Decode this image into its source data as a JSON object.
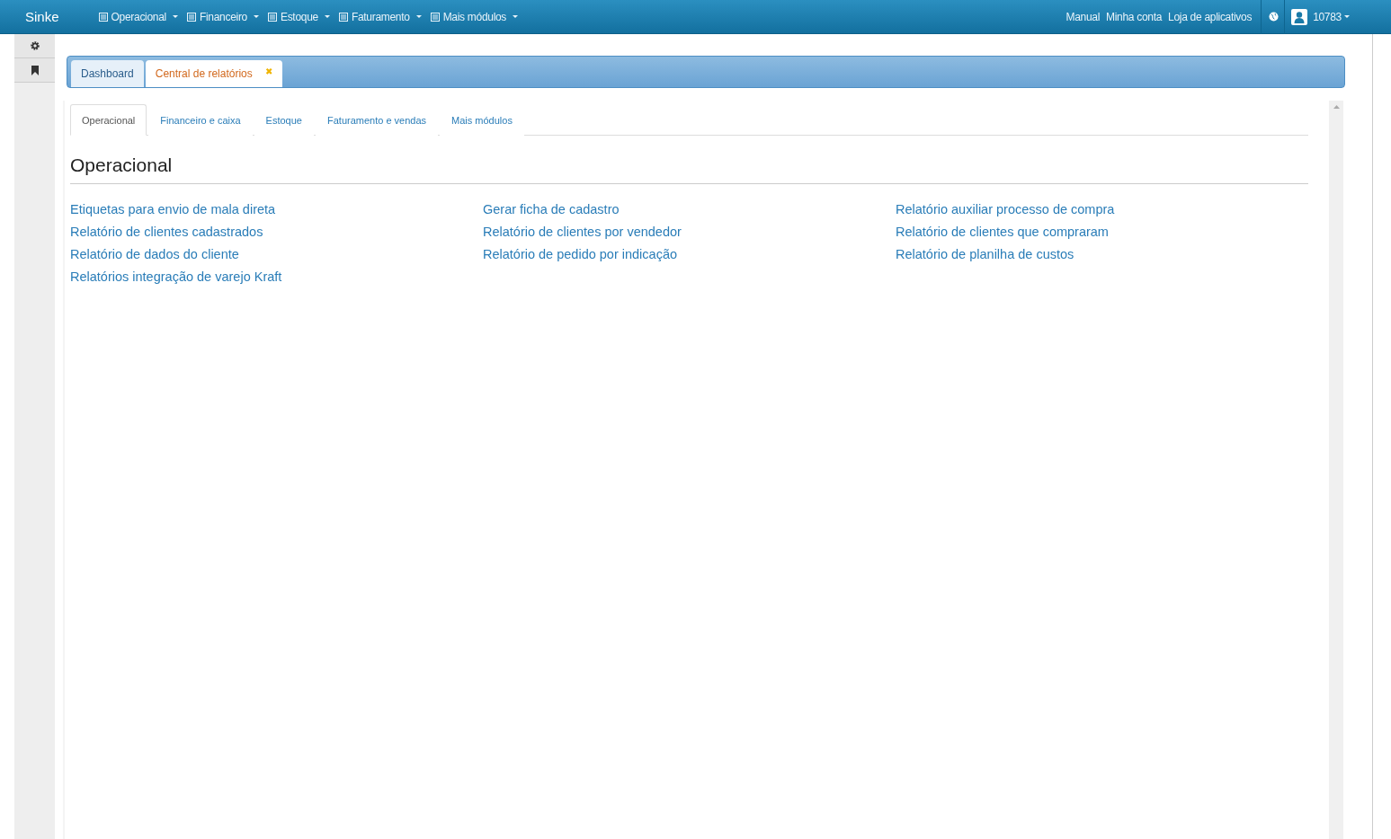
{
  "navbar": {
    "brand": "Sinke",
    "menus": [
      {
        "label": "Operacional"
      },
      {
        "label": "Financeiro"
      },
      {
        "label": "Estoque"
      },
      {
        "label": "Faturamento"
      },
      {
        "label": "Mais módulos"
      }
    ],
    "links": [
      "Manual",
      "Minha conta",
      "Loja de aplicativos"
    ],
    "user": "10783"
  },
  "doc_tabs": [
    {
      "label": "Dashboard",
      "selected": false,
      "closable": false
    },
    {
      "label": "Central de relatórios",
      "selected": true,
      "closable": true
    }
  ],
  "close_glyph": "✖",
  "report_tabs": [
    {
      "label": "Operacional",
      "selected": true
    },
    {
      "label": "Financeiro e caixa",
      "selected": false
    },
    {
      "label": "Estoque",
      "selected": false
    },
    {
      "label": "Faturamento e vendas",
      "selected": false
    },
    {
      "label": "Mais módulos",
      "selected": false
    }
  ],
  "heading": "Operacional",
  "link_columns": [
    [
      "Etiquetas para envio de mala direta",
      "Relatório de clientes cadastrados",
      "Relatório de dados do cliente",
      "Relatórios integração de varejo Kraft"
    ],
    [
      "Gerar ficha de cadastro",
      "Relatório de clientes por vendedor",
      "Relatório de pedido por indicação"
    ],
    [
      "Relatório auxiliar processo de compra",
      "Relatório de clientes que compraram",
      "Relatório de planilha de custos"
    ]
  ]
}
